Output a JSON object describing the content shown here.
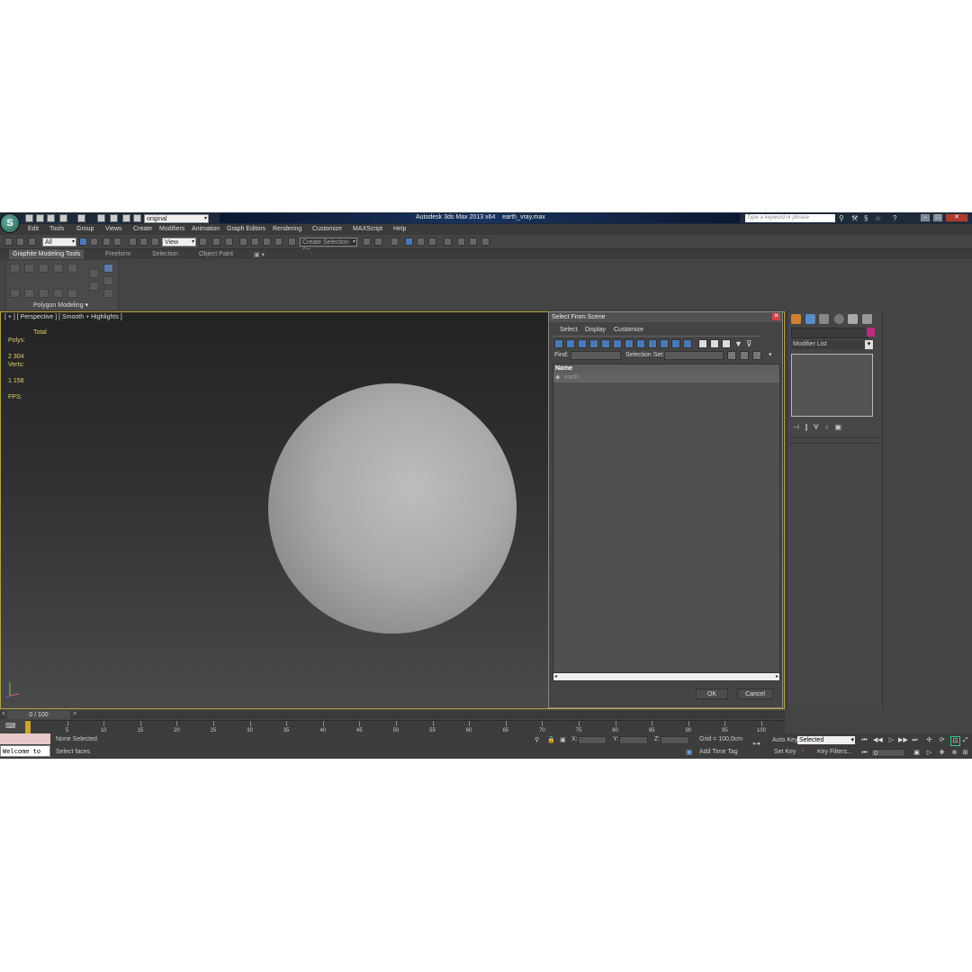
{
  "app": {
    "title": "Autodesk 3ds Max 2013 x64",
    "file": "earth_vray.max",
    "workspace": "original",
    "search_placeholder": "Type a keyword or phrase",
    "logo_glyph": "S"
  },
  "menus": [
    "Edit",
    "Tools",
    "Group",
    "Views",
    "Create",
    "Modifiers",
    "Animation",
    "Graph Editors",
    "Rendering",
    "Customize",
    "MAXScript",
    "Help"
  ],
  "toolbar": {
    "filter": "All",
    "ref_coord": "View",
    "selection_set": "Create Selection Se"
  },
  "ribbon": {
    "tabs": [
      "Graphite Modeling Tools",
      "Freeform",
      "Selection",
      "Object Paint"
    ],
    "panel_label": "Polygon Modeling"
  },
  "viewport": {
    "label": "[ + ] [ Perspective ] [ Smooth + Highlights ]",
    "stats": {
      "total_label": "Total",
      "polys_label": "Polys:",
      "polys_value": "2 304",
      "verts_label": "Verts:",
      "verts_value": "1 158",
      "fps_label": "FPS:"
    }
  },
  "command_panel": {
    "modifier_list": "Modifier List",
    "swatch_color": "#c02a7a"
  },
  "dialog": {
    "title": "Select From Scene",
    "menus": [
      "Select",
      "Display",
      "Customize"
    ],
    "find_label": "Find:",
    "selection_set_label": "Selection Set:",
    "column_name": "Name",
    "items": [
      "earth"
    ],
    "ok": "OK",
    "cancel": "Cancel"
  },
  "timeline": {
    "slider": "0 / 100",
    "ticks": [
      "5",
      "10",
      "15",
      "20",
      "25",
      "30",
      "35",
      "40",
      "45",
      "50",
      "55",
      "60",
      "65",
      "70",
      "75",
      "80",
      "85",
      "90",
      "95",
      "100"
    ]
  },
  "status": {
    "listener": "Welcome to M:",
    "selection": "None Selected",
    "prompt": "Select faces",
    "x_label": "X:",
    "y_label": "Y:",
    "z_label": "Z:",
    "grid": "Grid = 100,0cm",
    "add_time_tag": "Add Time Tag",
    "auto_key": "Auto Key",
    "set_key": "Set Key",
    "key_mode": "Selected",
    "key_filters": "Key Filters...",
    "frame": "0"
  }
}
